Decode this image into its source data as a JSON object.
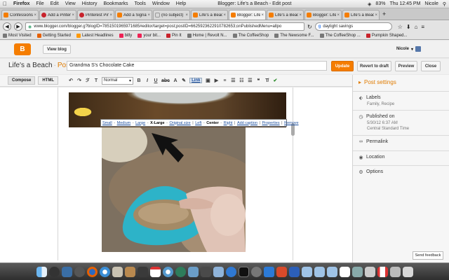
{
  "menubar": {
    "app": "Firefox",
    "items": [
      "File",
      "Edit",
      "View",
      "History",
      "Bookmarks",
      "Tools",
      "Window",
      "Help"
    ],
    "window_title": "Blogger: Life's a Beach - Edit post",
    "battery": "83%",
    "clock": "Thu 12:45 PM",
    "user": "Nicole"
  },
  "tabs": [
    {
      "label": "Confessions of...",
      "active": false
    },
    {
      "label": "Add a Pinterest...",
      "active": false
    },
    {
      "label": "Pinterest Pin It...",
      "active": false
    },
    {
      "label": "Add a Signatur...",
      "active": false
    },
    {
      "label": "(no subject) - t...",
      "active": false
    },
    {
      "label": "Life's a Beach",
      "active": false
    },
    {
      "label": "Blogger: Life's ...",
      "active": true
    },
    {
      "label": "Life's a Beach",
      "active": false
    },
    {
      "label": "Blogger: Life's...",
      "active": false
    },
    {
      "label": "Life's a Beach: ...",
      "active": false
    }
  ],
  "navbar": {
    "url": "www.blogger.com/blogger.g?blogID=7851501965971685#editor/target=post;postID=6625923622910782653;onPublishedMenu=allpo",
    "search": "daylight savings"
  },
  "bookmarks": [
    "Most Visited",
    "Getting Started",
    "Latest Headlines",
    "bitly",
    "your bit...",
    "Pin It",
    "Home | Revolt N...",
    "The CoffeeShop",
    "The Newsome F...",
    "The CoffeeShop ...",
    "Pumpkin Shaped..."
  ],
  "blogger": {
    "logo": "B",
    "view_blog": "View blog",
    "user": "Nicole",
    "blog_name": "Life's a Beach",
    "dot": "·",
    "section": "Post",
    "post_title": "Grandma S's Chocolate Cake",
    "buttons": {
      "update": "Update",
      "revert": "Revert to draft",
      "preview": "Preview",
      "close": "Close"
    }
  },
  "toolbar": {
    "compose": "Compose",
    "html": "HTML",
    "format": "Normal",
    "link": "Link"
  },
  "image_menu": {
    "options": [
      "Small",
      "Medium",
      "Large",
      "X-Large",
      "Original size"
    ],
    "align": [
      "Left",
      "Center",
      "Right"
    ],
    "selected_size": "X-Large",
    "selected_align": "Center",
    "add_caption": "Add caption",
    "properties": "Properties",
    "remove": "Remove"
  },
  "sidebar": {
    "title": "Post settings",
    "labels": {
      "heading": "Labels",
      "value": "Family, Recipe"
    },
    "published": {
      "heading": "Published on",
      "date": "5/30/12 6:37 AM",
      "tz": "Central Standard Time"
    },
    "permalink": "Permalink",
    "location": "Location",
    "options": "Options",
    "send_feedback": "Send feedback"
  },
  "colors": {
    "accent": "#f57d00",
    "link": "#1a4c9c"
  }
}
